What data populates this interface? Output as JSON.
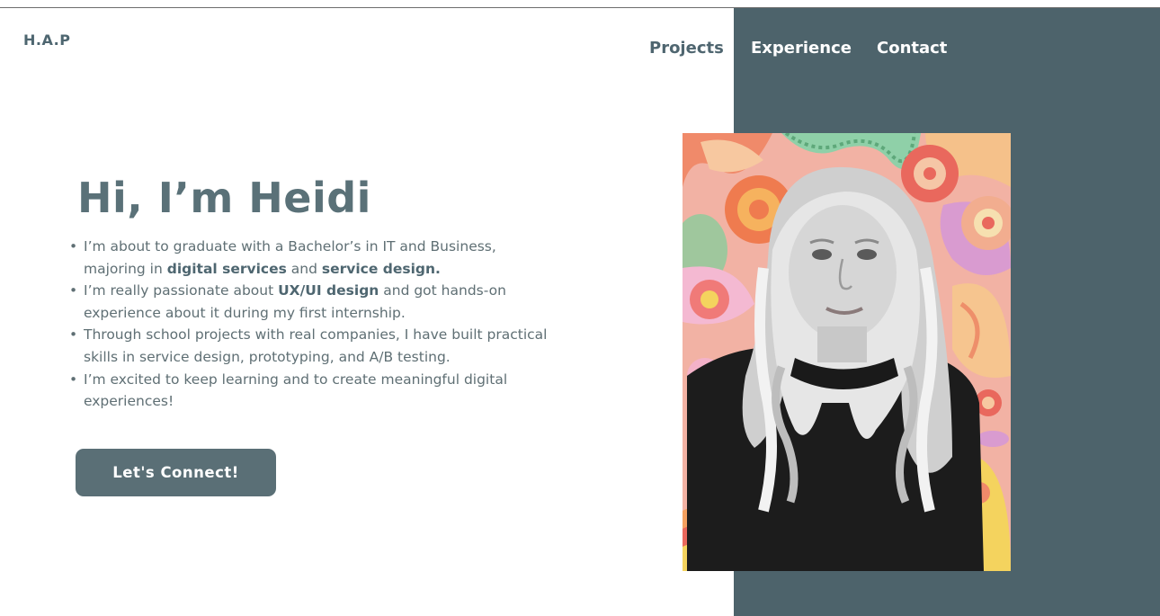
{
  "brand": {
    "logo": "H.A.P"
  },
  "nav": {
    "items": [
      {
        "label": "Projects"
      },
      {
        "label": "Experience"
      },
      {
        "label": "Contact"
      }
    ]
  },
  "hero": {
    "title": "Hi, I’m Heidi",
    "bullets": [
      {
        "parts": [
          "I’m about to graduate with a Bachelor’s in IT and Business, majoring in ",
          "digital services",
          " and ",
          "service design."
        ]
      },
      {
        "parts": [
          "I’m really passionate about ",
          "UX/UI design",
          " and got hands-on experience about it during my first internship."
        ]
      },
      {
        "parts": [
          "Through school projects with real companies, I have built practical skills in service design, prototyping, and A/B testing."
        ]
      },
      {
        "parts": [
          "I’m excited to keep learning and to create meaningful digital experiences!"
        ]
      }
    ],
    "cta_label": "Let's Connect!"
  },
  "colors": {
    "panel": "#4d636b",
    "accent": "#5a6f76",
    "heading": "#5a7178",
    "body_text": "#5f6f74"
  },
  "photo": {
    "icon": "portrait-photo"
  }
}
